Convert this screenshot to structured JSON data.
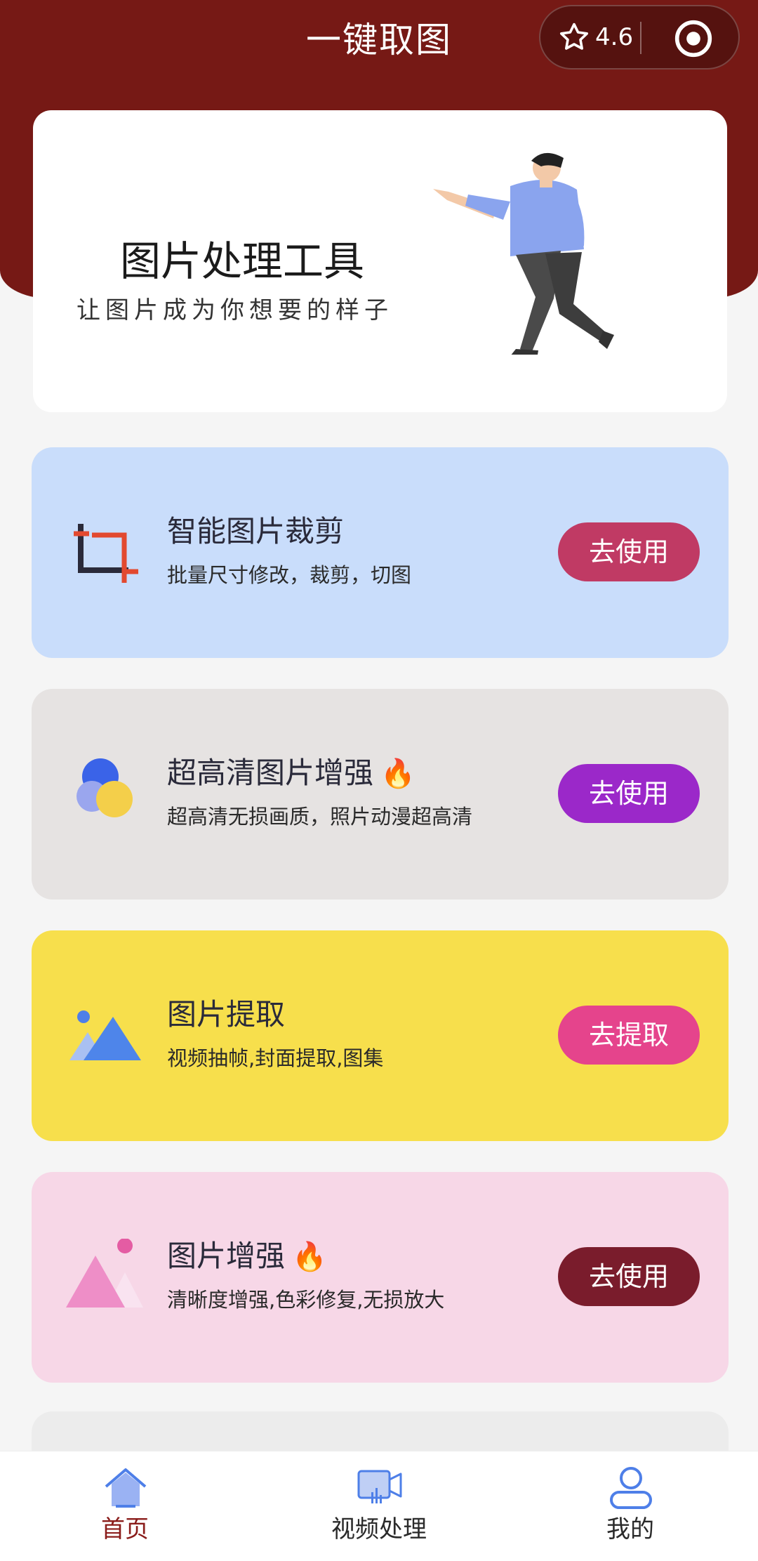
{
  "header": {
    "title": "一键取图",
    "rating": "4.6"
  },
  "banner": {
    "title": "图片处理工具",
    "subtitle": "让图片成为你想要的样子"
  },
  "cards": [
    {
      "title": "智能图片裁剪",
      "desc": "批量尺寸修改，裁剪，切图",
      "button": "去使用",
      "bg": "#c9ddfb",
      "button_color": "#c03a64",
      "icon": "crop-icon"
    },
    {
      "title": "超高清图片增强",
      "flame": "🔥",
      "desc": "超高清无损画质，照片动漫超高清",
      "button": "去使用",
      "bg": "#e6e3e2",
      "button_color": "#9b28c9",
      "icon": "circles-icon"
    },
    {
      "title": "图片提取",
      "desc": "视频抽帧,封面提取,图集",
      "button": "去提取",
      "bg": "#f7df4c",
      "button_color": "#e5448c",
      "icon": "image-mountain-icon"
    },
    {
      "title": "图片增强",
      "flame": "🔥",
      "desc": "清晰度增强,色彩修复,无损放大",
      "button": "去使用",
      "bg": "#f7d7e7",
      "button_color": "#7a1c2c",
      "icon": "pink-mountain-icon"
    }
  ],
  "tabbar": [
    {
      "label": "首页",
      "icon": "home-icon",
      "active": true
    },
    {
      "label": "视频处理",
      "icon": "video-icon",
      "active": false
    },
    {
      "label": "我的",
      "icon": "user-icon",
      "active": false
    }
  ],
  "colors": {
    "header_bg": "#761915",
    "page_bg": "#f5f5f5",
    "active_tab": "#8a1c1a"
  }
}
